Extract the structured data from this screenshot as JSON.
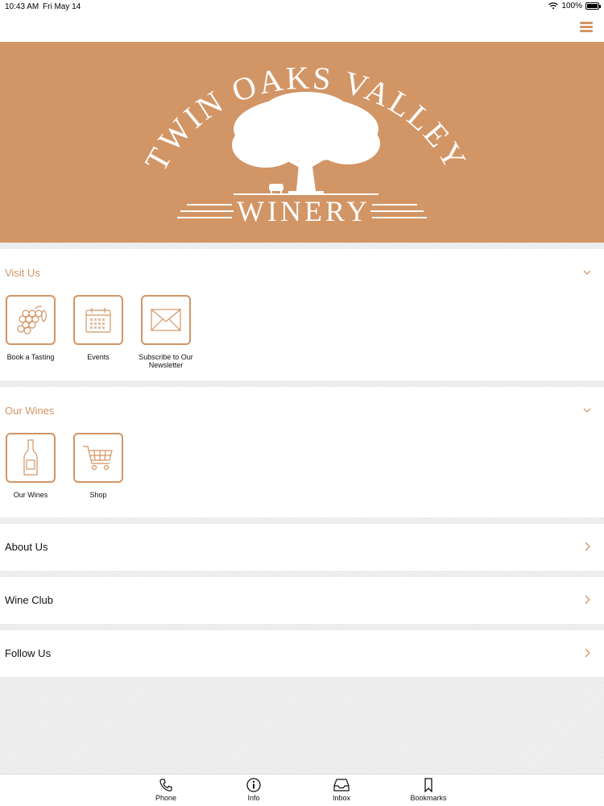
{
  "status": {
    "time": "10:43 AM",
    "date": "Fri May 14",
    "battery": "100%",
    "battery_level": 1.0
  },
  "topbar": {
    "menu_icon": "hamburger-menu-icon"
  },
  "hero": {
    "logo_top": "TWIN OAKS VALLEY",
    "logo_bottom": "WINERY",
    "background": "#d29565"
  },
  "colors": {
    "accent": "#d29565",
    "background": "#efefef"
  },
  "visit_us": {
    "title": "Visit Us",
    "tiles": [
      {
        "label": "Book a Tasting",
        "icon": "grapes-icon"
      },
      {
        "label": "Events",
        "icon": "calendar-icon"
      },
      {
        "label": "Subscribe to Our Newsletter",
        "icon": "envelope-icon"
      }
    ]
  },
  "our_wines": {
    "title": "Our Wines",
    "tiles": [
      {
        "label": "Our Wines",
        "icon": "wine-bottle-icon"
      },
      {
        "label": "Shop",
        "icon": "shopping-cart-icon"
      }
    ]
  },
  "rows": [
    {
      "label": "About Us"
    },
    {
      "label": "Wine Club"
    },
    {
      "label": "Follow Us"
    }
  ],
  "tabbar": [
    {
      "label": "Phone",
      "icon": "phone-icon"
    },
    {
      "label": "Info",
      "icon": "info-icon"
    },
    {
      "label": "Inbox",
      "icon": "inbox-icon"
    },
    {
      "label": "Bookmarks",
      "icon": "bookmark-icon"
    }
  ]
}
